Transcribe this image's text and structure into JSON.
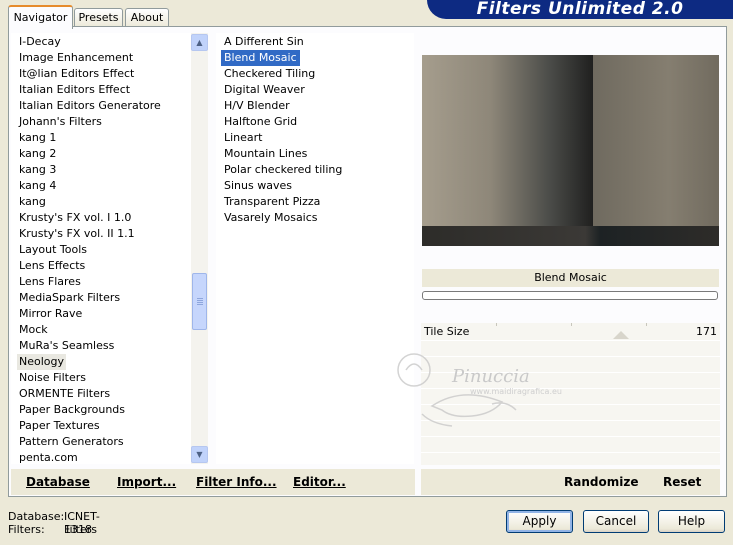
{
  "header": {
    "title": "Filters Unlimited 2.0"
  },
  "tabs": [
    {
      "label": "Navigator",
      "active": true
    },
    {
      "label": "Presets",
      "active": false
    },
    {
      "label": "About",
      "active": false
    }
  ],
  "categories": {
    "items": [
      "I-Decay",
      "Image Enhancement",
      "It@lian Editors Effect",
      "Italian Editors Effect",
      "Italian Editors Generatore",
      "Johann's Filters",
      "kang 1",
      "kang 2",
      "kang 3",
      "kang 4",
      "kang",
      "Krusty's FX vol. I 1.0",
      "Krusty's FX vol. II 1.1",
      "Layout Tools",
      "Lens Effects",
      "Lens Flares",
      "MediaSpark Filters",
      "Mirror Rave",
      "Mock",
      "MuRa's Seamless",
      "Neology",
      "Noise Filters",
      "ORMENTE Filters",
      "Paper Backgrounds",
      "Paper Textures",
      "Pattern Generators",
      "penta.com"
    ],
    "selected": "Neology"
  },
  "filters": {
    "items": [
      "A Different Sin",
      "Blend Mosaic",
      "Checkered Tiling",
      "Digital Weaver",
      "H/V Blender",
      "Halftone Grid",
      "Lineart",
      "Mountain Lines",
      "Polar checkered tiling",
      "Sinus waves",
      "Transparent Pizza",
      "Vasarely Mosaics"
    ],
    "selected": "Blend Mosaic"
  },
  "preview": {
    "filter_name": "Blend Mosaic",
    "progress": 0
  },
  "parameters": [
    {
      "label": "Tile Size",
      "value": "171"
    }
  ],
  "bottom_left_buttons": {
    "database": "Database",
    "import": "Import...",
    "filter_info": "Filter Info...",
    "editor": "Editor..."
  },
  "bottom_right_buttons": {
    "randomize": "Randomize",
    "reset": "Reset"
  },
  "status": {
    "database_label": "Database:",
    "database_value": "ICNET-Filters",
    "filters_label": "Filters:",
    "filters_value": "1318"
  },
  "dialog_buttons": {
    "apply": "Apply",
    "cancel": "Cancel",
    "help": "Help"
  },
  "watermark": {
    "name": "Pinuccia",
    "url": "www.maidiragrafica.eu"
  },
  "colors": {
    "header_bg": "#0d2a82",
    "selection": "#316ac5",
    "window_bg": "#ece9d8"
  }
}
